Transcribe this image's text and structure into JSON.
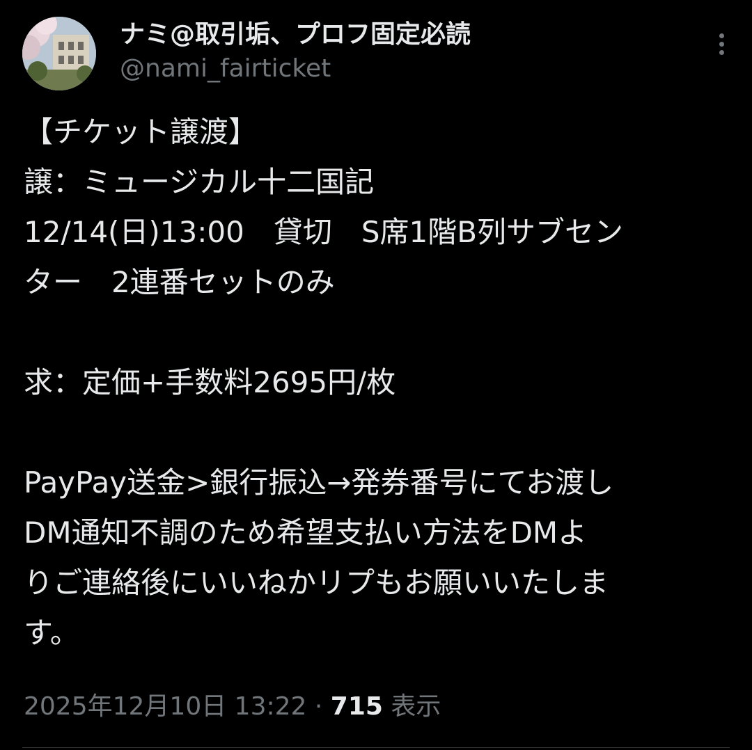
{
  "author": {
    "display_name": "ナミ@取引垢、プロフ固定必読",
    "handle": "@nami_fairticket"
  },
  "post": {
    "lines": [
      "【チケット譲渡】",
      "譲：ミュージカル十二国記",
      "12/14(日)13:00　貸切　S席1階B列サブセン",
      "ター　2連番セットのみ",
      "",
      "求：定価+手数料2695円/枚",
      "",
      "PayPay送金>銀行振込→発券番号にてお渡し",
      "DM通知不調のため希望支払い方法をDMよ",
      "りご連絡後にいいねかリプもお願いいたしま",
      "す。"
    ]
  },
  "meta": {
    "timestamp": "2025年12月10日 13:22",
    "separator": " · ",
    "view_count": "715",
    "view_label": " 表示"
  },
  "icons": {
    "more": "more-vertical-icon"
  },
  "colors": {
    "background": "#000000",
    "primary_text": "#e7e9ea",
    "secondary_text": "#71767b",
    "divider": "#2f3336"
  }
}
